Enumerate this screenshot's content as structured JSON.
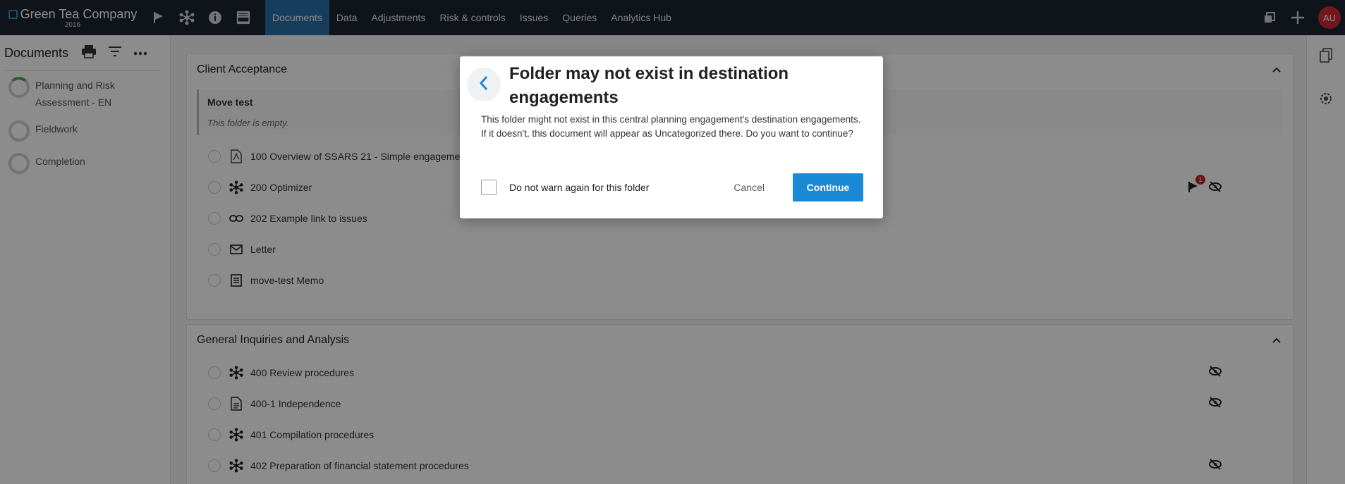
{
  "brand": {
    "name": "Green Tea Company",
    "year": "2016"
  },
  "nav": {
    "items": [
      "Documents",
      "Data",
      "Adjustments",
      "Risk & controls",
      "Issues",
      "Queries",
      "Analytics Hub"
    ],
    "active": "Documents"
  },
  "user": {
    "initials": "AU"
  },
  "sidebar": {
    "title": "Documents",
    "items": [
      {
        "label": "Planning and Risk Assessment - EN"
      },
      {
        "label": "Fieldwork"
      },
      {
        "label": "Completion"
      }
    ]
  },
  "sections": [
    {
      "title": "Client Acceptance",
      "folder": {
        "name": "Move test",
        "empty_text": "This folder is empty."
      },
      "docs": [
        {
          "label": "100 Overview of SSARS 21 - Simple engagement",
          "icon": "pdf-icon"
        },
        {
          "label": "200 Optimizer",
          "icon": "optimizer-icon",
          "flag_count": "1"
        },
        {
          "label": "202 Example link to issues",
          "icon": "link-icon"
        },
        {
          "label": "Letter",
          "icon": "mail-icon"
        },
        {
          "label": "move-test Memo",
          "icon": "memo-icon"
        }
      ]
    },
    {
      "title": "General Inquiries and Analysis",
      "docs": [
        {
          "label": "400 Review procedures",
          "icon": "optimizer-icon"
        },
        {
          "label": "400-1 Independence",
          "icon": "document-icon"
        },
        {
          "label": "401 Compilation procedures",
          "icon": "optimizer-icon"
        },
        {
          "label": "402 Preparation of financial statement procedures",
          "icon": "optimizer-icon"
        }
      ]
    }
  ],
  "modal": {
    "title": "Folder may not exist in destination engagements",
    "body": "This folder might not exist in this central planning engagement's destination engagements. If it doesn't, this document will appear as Uncategorized there. Do you want to continue?",
    "checkbox_label": "Do not warn again for this folder",
    "cancel_label": "Cancel",
    "continue_label": "Continue"
  },
  "colors": {
    "topbar": "#1c2430",
    "active_tab": "#2b6fa8",
    "primary": "#1b8ad6",
    "avatar": "#d22b3a"
  }
}
